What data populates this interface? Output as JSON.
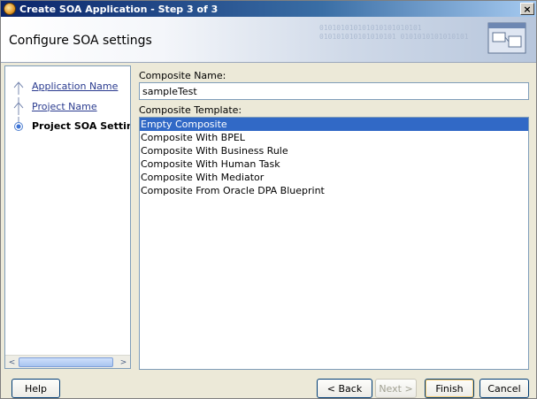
{
  "window": {
    "title": "Create SOA Application - Step 3 of 3",
    "close_label": "×"
  },
  "header": {
    "page_title": "Configure SOA settings",
    "binary_decoration": "010101010101010101010101 010101010101010101 0101010101010101"
  },
  "steps": [
    {
      "label": "Application Name",
      "state": "done"
    },
    {
      "label": "Project Name",
      "state": "done"
    },
    {
      "label": "Project SOA Settings",
      "state": "current"
    }
  ],
  "steps_scrollbar": {
    "left_arrow": "<",
    "right_arrow": ">"
  },
  "form": {
    "composite_name_label": "Composite Name:",
    "composite_name_value": "sampleTest",
    "composite_template_label": "Composite Template:",
    "templates": [
      "Empty Composite",
      "Composite With BPEL",
      "Composite With Business Rule",
      "Composite With Human Task",
      "Composite With Mediator",
      "Composite From Oracle DPA Blueprint"
    ],
    "selected_template": "Empty Composite"
  },
  "buttons": {
    "help": "Help",
    "back": "< Back",
    "next": "Next >",
    "finish": "Finish",
    "cancel": "Cancel"
  },
  "colors": {
    "selection": "#3169c6",
    "link": "#2a3b8f",
    "titlebar_start": "#0a246a"
  }
}
